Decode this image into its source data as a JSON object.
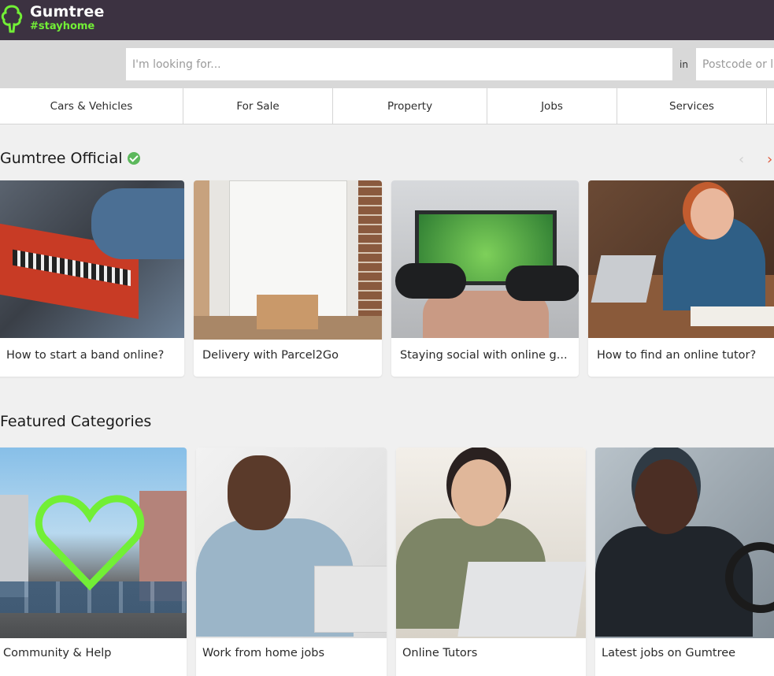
{
  "header": {
    "logo_name": "Gumtree",
    "logo_tagline": "#stayhome",
    "bg_color": "#3c3241",
    "accent_color": "#72ef36"
  },
  "search": {
    "query_placeholder": "I'm looking for...",
    "in_label": "in",
    "location_placeholder": "Postcode or l"
  },
  "nav": {
    "categories": [
      {
        "label": "Cars & Vehicles"
      },
      {
        "label": "For Sale"
      },
      {
        "label": "Property"
      },
      {
        "label": "Jobs"
      },
      {
        "label": "Services"
      }
    ]
  },
  "official": {
    "title": "Gumtree Official",
    "verified_icon": "check-circle-icon",
    "prev_icon": "chevron-left-icon",
    "next_icon": "chevron-right-icon",
    "cards": [
      {
        "caption": "How to start a band online?",
        "image": "keyboard-band-image"
      },
      {
        "caption": "Delivery with Parcel2Go",
        "image": "parcel-door-image"
      },
      {
        "caption": "Staying social with online g...",
        "image": "video-game-image"
      },
      {
        "caption": "How to find an online tutor?",
        "image": "study-tutor-image"
      }
    ]
  },
  "featured": {
    "title": "Featured Categories",
    "cards": [
      {
        "caption": "Community & Help",
        "image": "heart-street-image"
      },
      {
        "caption": "Work from home jobs",
        "image": "headphones-worker-image"
      },
      {
        "caption": "Online Tutors",
        "image": "waving-tutor-image"
      },
      {
        "caption": "Latest jobs on Gumtree",
        "image": "smiling-driver-image"
      }
    ]
  }
}
